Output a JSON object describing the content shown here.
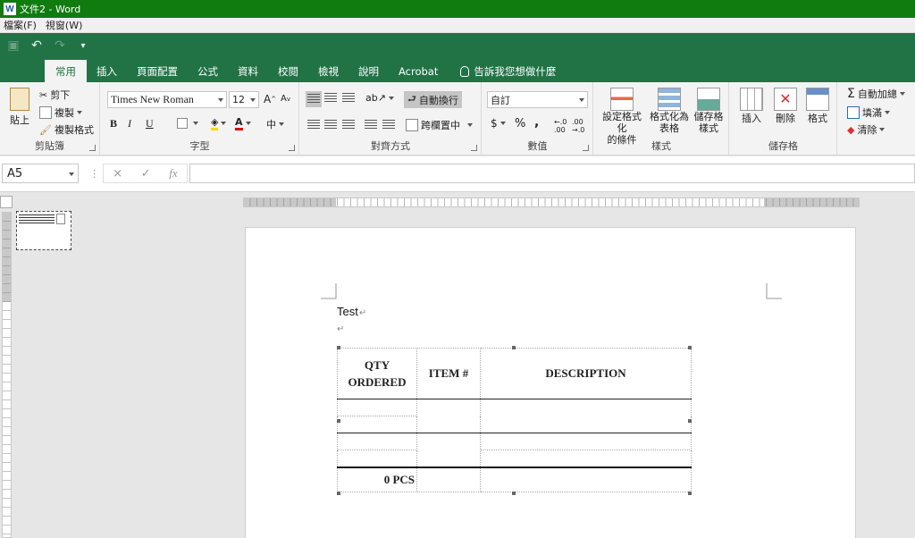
{
  "window": {
    "title": "文件2 - Word"
  },
  "menubar": [
    "檔案(F)",
    "視窗(W)"
  ],
  "tabs": [
    "常用",
    "插入",
    "頁面配置",
    "公式",
    "資料",
    "校閱",
    "檢視",
    "說明",
    "Acrobat"
  ],
  "tell_me": "告訴我您想做什麼",
  "ribbon": {
    "clipboard": {
      "label": "剪貼簿",
      "paste": "貼上",
      "cut": "剪下",
      "copy": "複製",
      "format_painter": "複製格式"
    },
    "font": {
      "label": "字型",
      "name": "Times New Roman",
      "size": "12",
      "bold": "B",
      "italic": "I",
      "underline": "U"
    },
    "alignment": {
      "label": "對齊方式",
      "wrap": "自動換行",
      "merge": "跨欄置中"
    },
    "number": {
      "label": "數值",
      "format": "自訂",
      "currency": "$",
      "percent": "%",
      "comma": ","
    },
    "styles": {
      "label": "樣式",
      "cond_format": "設定格式化\n的條件",
      "format_table": "格式化為\n表格",
      "cell_styles": "儲存格\n樣式"
    },
    "cells": {
      "label": "儲存格",
      "insert": "插入",
      "delete": "刪除",
      "format": "格式"
    },
    "editing": {
      "autosum": "自動加總",
      "fill": "填滿",
      "clear": "清除"
    }
  },
  "formula_bar": {
    "name_box": "A5",
    "cancel_icon": "×",
    "enter_icon": "✓",
    "fx": "fx"
  },
  "document": {
    "test_text": "Test",
    "table": {
      "headers": [
        "QTY\nORDERED",
        "ITEM #",
        "DESCRIPTION"
      ],
      "total": "0 PCS"
    }
  }
}
